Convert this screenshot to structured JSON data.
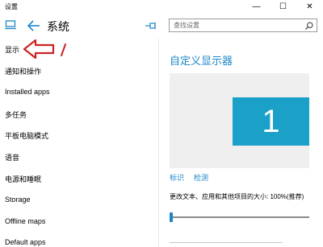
{
  "window": {
    "title": "设置",
    "minimize_glyph": "—",
    "maximize_glyph": "☐",
    "close_glyph": "✕"
  },
  "header": {
    "title": "系统",
    "search_placeholder": "查找设置"
  },
  "sidebar": {
    "items": [
      {
        "label": "显示",
        "active": true
      },
      {
        "label": "通知和操作"
      },
      {
        "label": "Installed apps"
      },
      {
        "label": "多任务"
      },
      {
        "label": "平板电脑模式"
      },
      {
        "label": "语音"
      },
      {
        "label": "电源和睡眠"
      },
      {
        "label": "Storage"
      },
      {
        "label": "Offline maps"
      },
      {
        "label": "Default apps"
      }
    ]
  },
  "main": {
    "title": "自定义显示器",
    "monitor_number": "1",
    "identify_link": "标识",
    "detect_link": "检测",
    "scale_label": "更改文本、应用和其他项目的大小: 100%(推荐)",
    "scale_fraction": 0.0
  },
  "colors": {
    "accent": "#1e86c8",
    "monitor_tile": "#1ba0c8",
    "annotation_arrow": "#cc2222"
  }
}
